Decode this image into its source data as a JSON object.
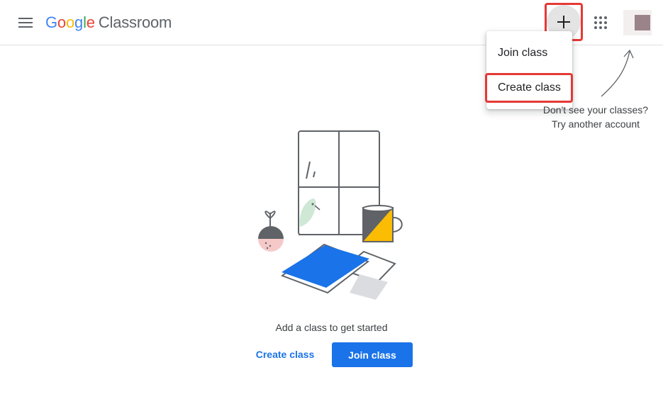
{
  "header": {
    "brand": {
      "letters": [
        {
          "char": "G",
          "color": "#4285f4"
        },
        {
          "char": "o",
          "color": "#ea4335"
        },
        {
          "char": "o",
          "color": "#fbbc05"
        },
        {
          "char": "g",
          "color": "#4285f4"
        },
        {
          "char": "l",
          "color": "#34a853"
        },
        {
          "char": "e",
          "color": "#ea4335"
        }
      ],
      "product": "Classroom"
    },
    "icons": {
      "menu": "hamburger-menu-icon",
      "plus": "plus-icon",
      "apps": "apps-grid-icon",
      "avatar": "account-avatar"
    }
  },
  "dropdown": {
    "items": [
      {
        "label": "Join class"
      },
      {
        "label": "Create class"
      }
    ]
  },
  "hint": {
    "line1": "Don't see your classes?",
    "line2": "Try another account"
  },
  "empty_state": {
    "message": "Add a class to get started",
    "create_label": "Create class",
    "join_label": "Join class"
  },
  "colors": {
    "accent": "#1a73e8",
    "highlight": "#e53935"
  }
}
